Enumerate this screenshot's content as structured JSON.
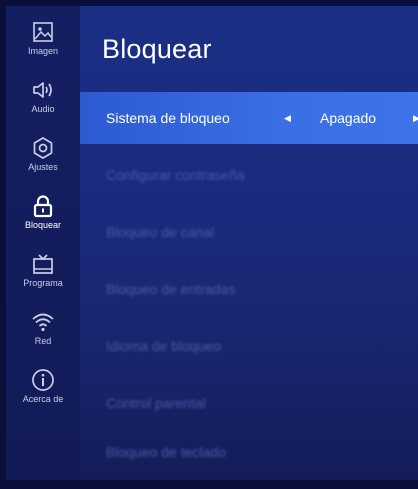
{
  "sidebar": {
    "items": [
      {
        "label": "Imagen",
        "icon": "image-icon"
      },
      {
        "label": "Audio",
        "icon": "speaker-icon"
      },
      {
        "label": "Ajustes",
        "icon": "gear-icon"
      },
      {
        "label": "Bloquear",
        "icon": "lock-icon"
      },
      {
        "label": "Programa",
        "icon": "tv-icon"
      },
      {
        "label": "Red",
        "icon": "wifi-icon"
      },
      {
        "label": "Acerca de",
        "icon": "info-icon"
      }
    ],
    "active_index": 3
  },
  "page": {
    "title": "Bloquear"
  },
  "menu": {
    "items": [
      {
        "label": "Sistema de bloqueo",
        "value": "Apagado",
        "selected": true
      },
      {
        "label": "Configurar contraseña",
        "enabled": false
      },
      {
        "label": "Bloqueo de canal",
        "enabled": false
      },
      {
        "label": "Bloqueo de entradas",
        "enabled": false
      },
      {
        "label": "Idioma de bloqueo",
        "enabled": false
      },
      {
        "label": "Control parental",
        "enabled": false
      },
      {
        "label": "Bloqueo de teclado",
        "enabled": false
      }
    ]
  },
  "colors": {
    "background": "#1a2f86",
    "sidebar": "#141f63",
    "selection": "#3a6fe6"
  }
}
